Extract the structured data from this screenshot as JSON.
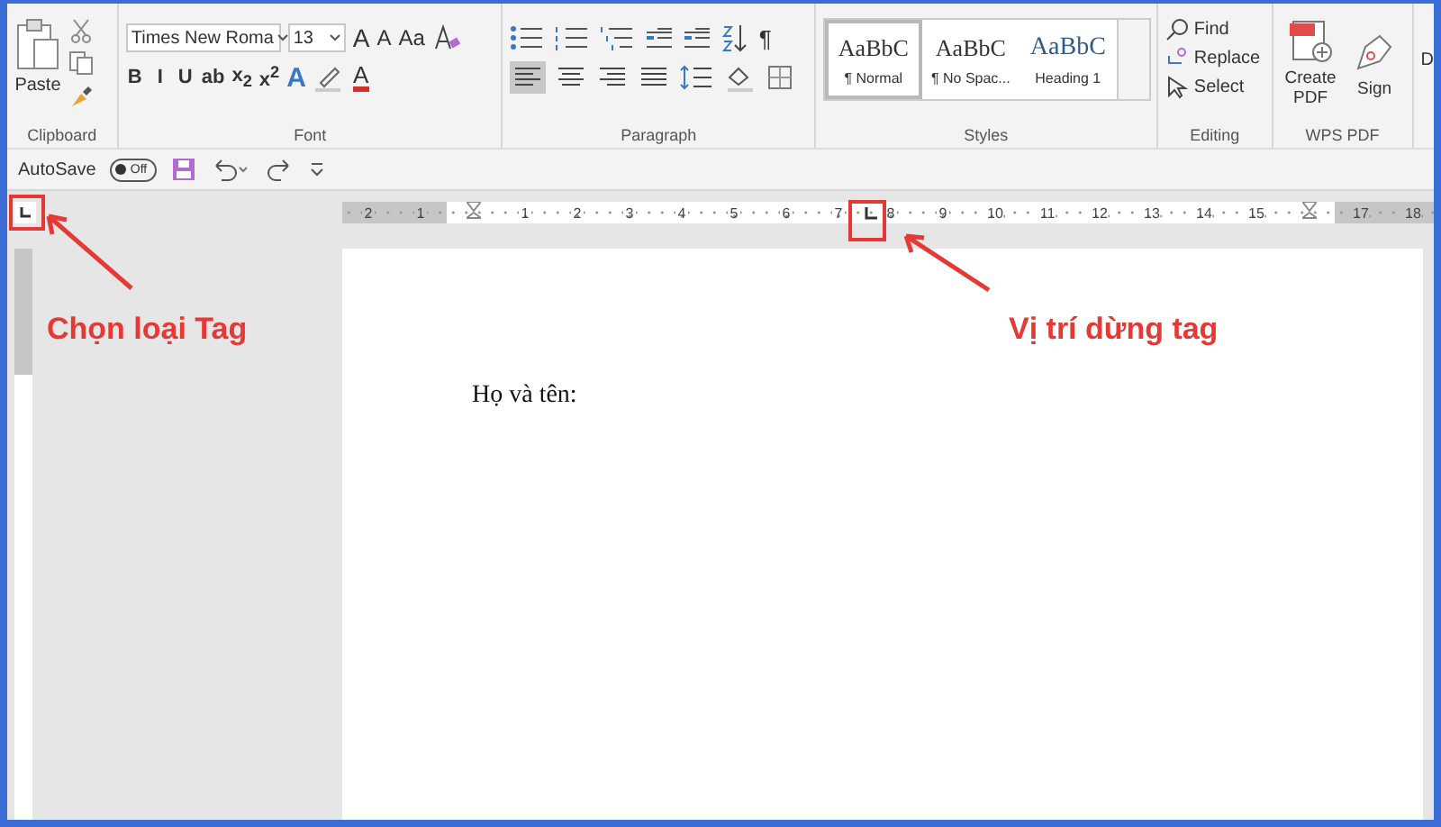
{
  "ribbon": {
    "clipboard": {
      "paste": "Paste",
      "label": "Clipboard"
    },
    "font": {
      "font_name": "Times New Roma",
      "font_size": "13",
      "grow": "A",
      "shrink": "A",
      "change_case": "Aa",
      "format_buttons": [
        "B",
        "I",
        "U",
        "ab",
        "x$_{2}$",
        "x$^{2}$"
      ],
      "text_effect": "A",
      "font_color": "A",
      "label": "Font"
    },
    "paragraph": {
      "pilcrow": "¶",
      "label": "Paragraph"
    },
    "styles": {
      "items": [
        {
          "preview": "AaBbC",
          "name": "¶ Normal",
          "kind": "body",
          "selected": true
        },
        {
          "preview": "AaBbC",
          "name": "¶ No Spac...",
          "kind": "body",
          "selected": false
        },
        {
          "preview": "AaBbC",
          "name": "Heading 1",
          "kind": "heading",
          "selected": false
        }
      ],
      "label": "Styles"
    },
    "editing": {
      "items": [
        {
          "label": "Find",
          "kind": "find"
        },
        {
          "label": "Replace",
          "kind": "replace"
        },
        {
          "label": "Select",
          "kind": "select"
        }
      ],
      "label": "Editing"
    },
    "wps_pdf": {
      "items": [
        {
          "label": "Create PDF",
          "kind": "create"
        },
        {
          "label": "Sign",
          "kind": "sign"
        }
      ],
      "label": "WPS PDF"
    },
    "cut_off": "D"
  },
  "quick_access": {
    "autosave": "AutoSave",
    "toggle": "Off",
    "on": false
  },
  "ruler": {
    "marks": [
      {
        "label": "2",
        "shaded": true
      },
      {
        "label": "1",
        "shaded": true
      },
      {
        "kind": "indent",
        "shaded": false
      },
      {
        "label": "1",
        "shaded": false
      },
      {
        "label": "2",
        "shaded": false
      },
      {
        "label": "3",
        "shaded": false
      },
      {
        "label": "4",
        "shaded": false
      },
      {
        "label": "5",
        "shaded": false
      },
      {
        "label": "6",
        "shaded": false
      },
      {
        "label": "7",
        "shaded": false
      },
      {
        "label": "8",
        "shaded": false
      },
      {
        "label": "9",
        "shaded": false
      },
      {
        "label": "10",
        "shaded": false
      },
      {
        "label": "11",
        "shaded": false
      },
      {
        "label": "12",
        "shaded": false
      },
      {
        "label": "13",
        "shaded": false
      },
      {
        "label": "14",
        "shaded": false
      },
      {
        "label": "15",
        "shaded": false
      },
      {
        "kind": "indent",
        "shaded": false
      },
      {
        "label": "17",
        "shaded": true
      },
      {
        "label": "18",
        "shaded": true
      }
    ]
  },
  "document": {
    "text": "Họ và tên:"
  },
  "annotations": [
    {
      "label": "Chọn loại Tag"
    },
    {
      "label": "Vị trí dừng tag"
    }
  ]
}
